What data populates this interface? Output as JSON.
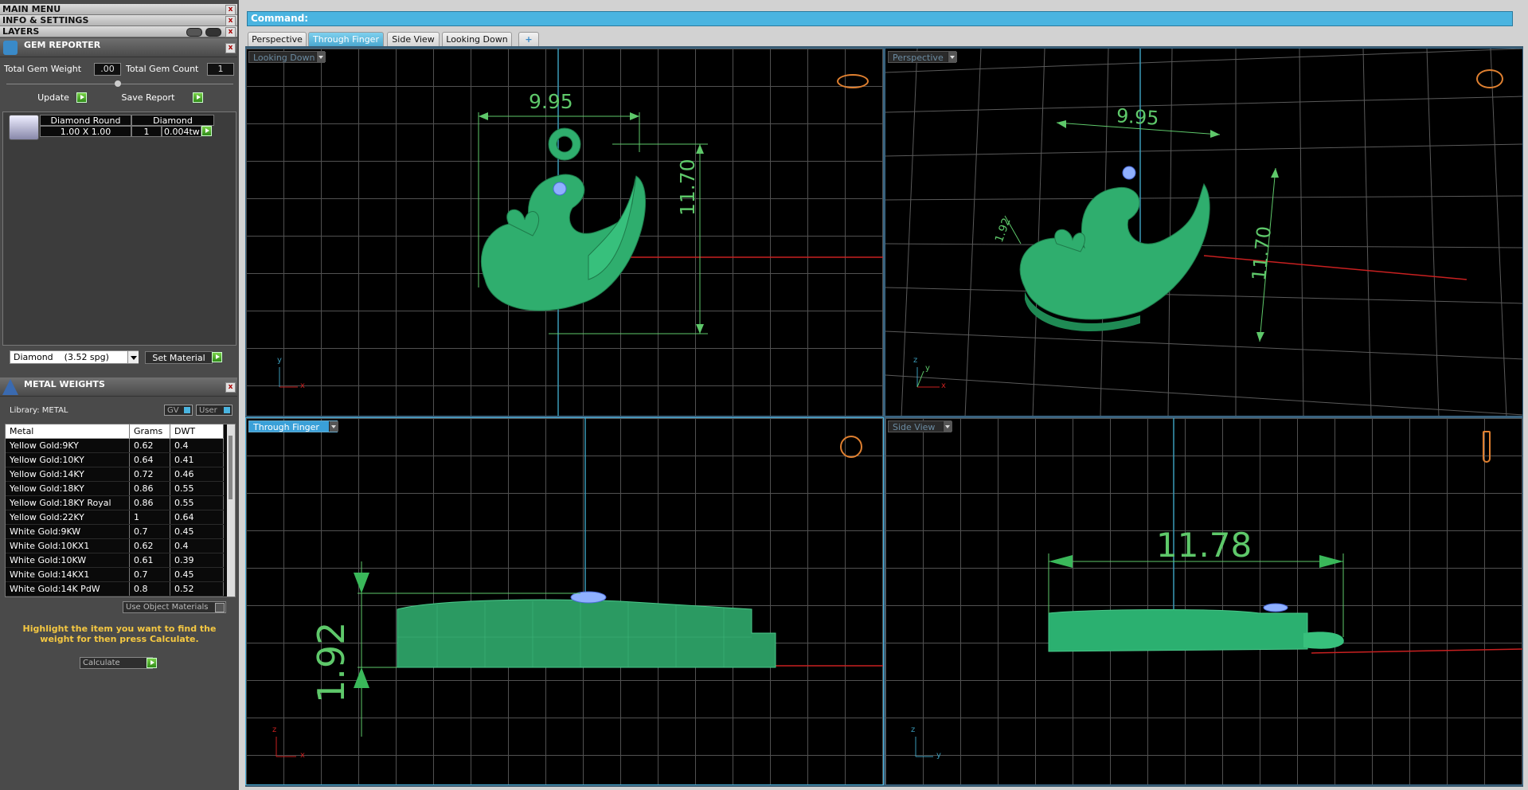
{
  "menus": {
    "main_menu": "MAIN MENU",
    "info_settings": "INFO & SETTINGS",
    "layers": "LAYERS"
  },
  "gem_reporter": {
    "title": "GEM REPORTER",
    "total_gem_weight_label": "Total Gem Weight",
    "total_gem_weight_value": ".00",
    "total_gem_count_label": "Total Gem Count",
    "total_gem_count_value": "1",
    "update_label": "Update",
    "save_report_label": "Save Report",
    "gem_row": {
      "name": "Diamond Round",
      "type": "Diamond",
      "size": "1.00 X 1.00",
      "count": "1",
      "weight": "0.004tw"
    },
    "material_select": "Diamond    (3.52 spg)",
    "set_material_label": "Set Material"
  },
  "metal_weights": {
    "title": "METAL WEIGHTS",
    "library_label": "Library: METAL",
    "gv_label": "GV",
    "user_label": "User",
    "columns": [
      "Metal",
      "Grams",
      "DWT"
    ],
    "rows": [
      [
        "Yellow Gold:9KY",
        "0.62",
        "0.4"
      ],
      [
        "Yellow Gold:10KY",
        "0.64",
        "0.41"
      ],
      [
        "Yellow Gold:14KY",
        "0.72",
        "0.46"
      ],
      [
        "Yellow Gold:18KY",
        "0.86",
        "0.55"
      ],
      [
        "Yellow Gold:18KY Royal",
        "0.86",
        "0.55"
      ],
      [
        "Yellow Gold:22KY",
        "1",
        "0.64"
      ],
      [
        "White Gold:9KW",
        "0.7",
        "0.45"
      ],
      [
        "White Gold:10KX1",
        "0.62",
        "0.4"
      ],
      [
        "White Gold:10KW",
        "0.61",
        "0.39"
      ],
      [
        "White Gold:14KX1",
        "0.7",
        "0.45"
      ],
      [
        "White Gold:14K PdW",
        "0.8",
        "0.52"
      ]
    ],
    "use_object_materials": "Use Object Materials",
    "hint": "Highlight the item you want to find the weight for then press Calculate.",
    "calculate_label": "Calculate"
  },
  "command": {
    "label": "Command:"
  },
  "tabs": [
    "Perspective",
    "Through Finger",
    "Side View",
    "Looking Down"
  ],
  "active_tab": "Through Finger",
  "viewports": {
    "top_left": {
      "label": "Looking Down",
      "dim_width": "9.95",
      "dim_height": "11.70",
      "axis_a": "y",
      "axis_b": "x"
    },
    "top_right": {
      "label": "Perspective",
      "dim_width": "9.95",
      "dim_height": "11.70",
      "dim_thick": "1.92",
      "axis_a": "z",
      "axis_b": "y",
      "axis_c": "x"
    },
    "bottom_left": {
      "label": "Through Finger",
      "dim_thick": "1.92",
      "axis_a": "z",
      "axis_b": "x"
    },
    "bottom_right": {
      "label": "Side View",
      "dim_length": "11.78",
      "axis_a": "z",
      "axis_b": "y"
    }
  },
  "colors": {
    "accent_blue": "#4ab4e0",
    "model_green": "#2fae6e",
    "dimension_green": "#5ec86a",
    "axis_red": "#c82020",
    "gem_blue": "#8fb0ff"
  }
}
